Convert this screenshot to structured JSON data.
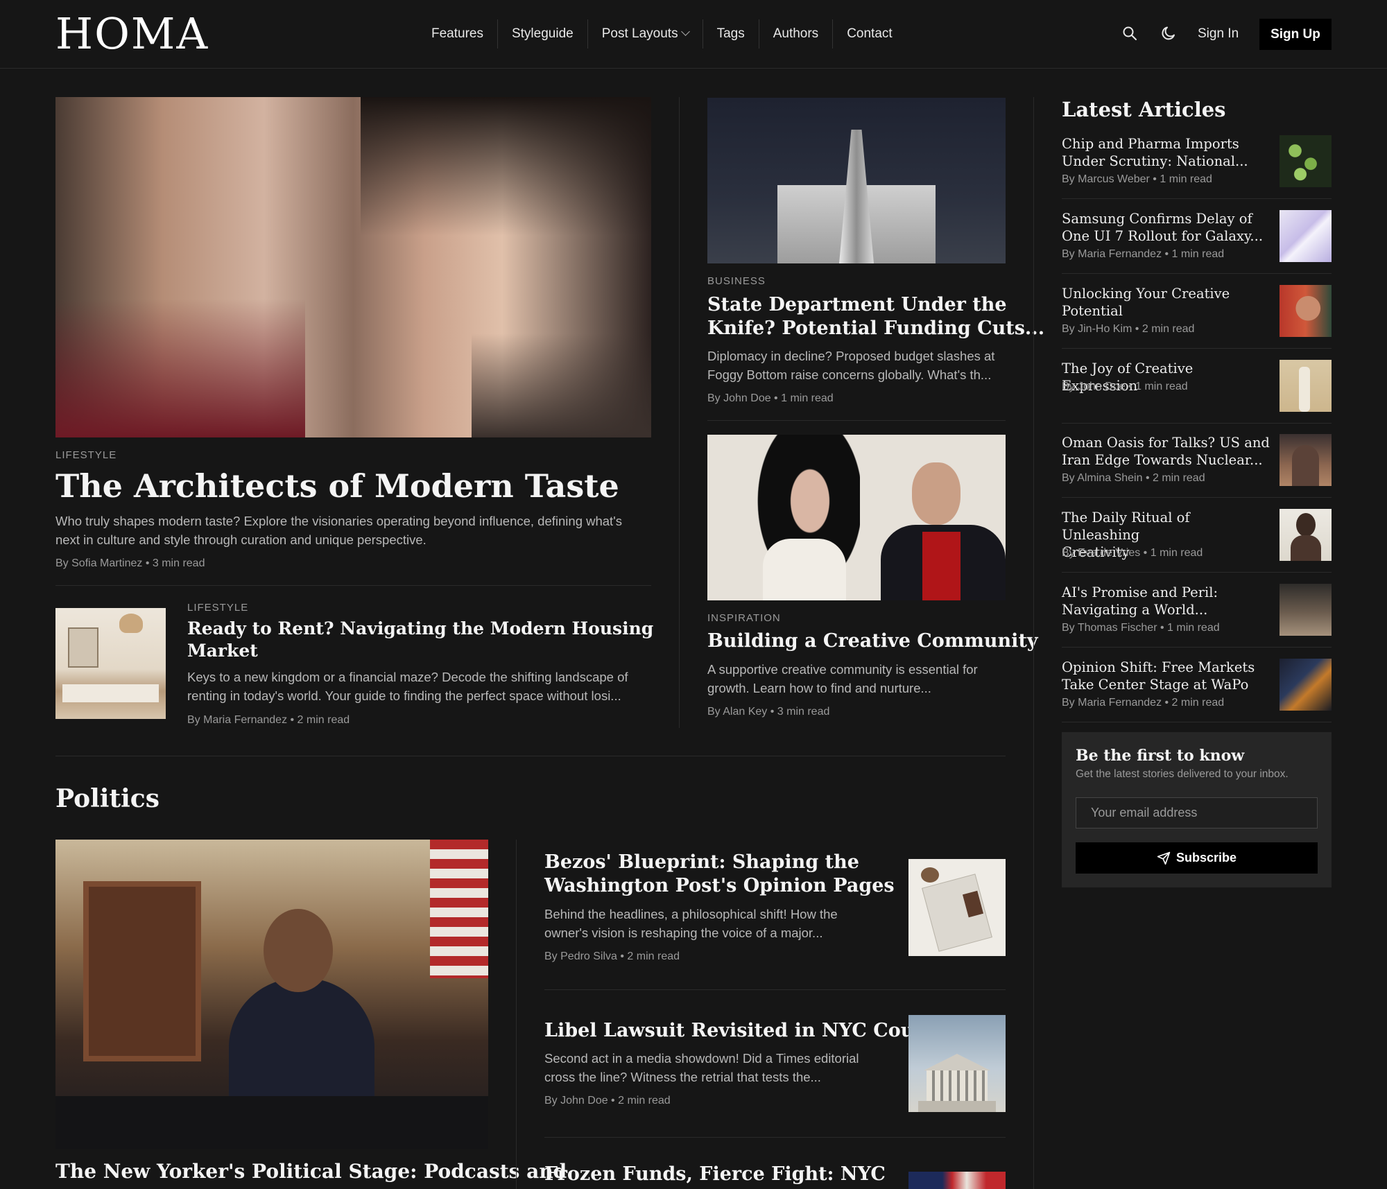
{
  "brand": {
    "logo": "HOMA"
  },
  "nav": {
    "items": [
      "Features",
      "Styleguide",
      "Post Layouts",
      "Tags",
      "Authors",
      "Contact"
    ],
    "sign_in": "Sign In",
    "sign_up": "Sign Up",
    "icons": [
      "search-icon",
      "moon-icon",
      "chevron-down-icon"
    ]
  },
  "hero": {
    "category": "LIFESTYLE",
    "title": "The Architects of Modern Taste",
    "excerpt_line1": "Who truly shapes modern taste? Explore the visionaries operating beyond influence, defining what's",
    "excerpt_line2": "next in culture and style through curation and unique perspective.",
    "meta": "By Sofia Martinez • 3 min read"
  },
  "secondary": {
    "category": "LIFESTYLE",
    "title_line1": "Ready to Rent? Navigating the Modern Housing",
    "title_line2": "Market",
    "excerpt_line1": "Keys to a new kingdom or a financial maze? Decode the shifting landscape of",
    "excerpt_line2": "renting in today's world. Your guide to finding the perfect space without losi...",
    "meta": "By Maria Fernandez • 2 min read"
  },
  "middle": [
    {
      "category": "BUSINESS",
      "title_line1": "State Department Under the",
      "title_line2": "Knife? Potential Funding Cuts...",
      "excerpt_line1": "Diplomacy in decline? Proposed budget slashes at",
      "excerpt_line2": "Foggy Bottom raise concerns globally. What's th...",
      "meta": "By John Doe • 1 min read"
    },
    {
      "category": "INSPIRATION",
      "title_line1": "Building a Creative Community",
      "excerpt_line1": "A supportive creative community is essential for",
      "excerpt_line2": "growth. Learn how to find and nurture...",
      "meta": "By Alan Key • 3 min read"
    }
  ],
  "sidebar": {
    "heading": "Latest Articles",
    "items": [
      {
        "l1": "Chip and Pharma Imports",
        "l2": "Under Scrutiny: National...",
        "meta": "By Marcus Weber • 1 min read"
      },
      {
        "l1": "Samsung Confirms Delay of",
        "l2": "One UI 7 Rollout for Galaxy...",
        "meta": "By Maria Fernandez • 1 min read"
      },
      {
        "l1": "Unlocking Your Creative",
        "l2": "Potential",
        "meta": "By Jin-Ho Kim • 2 min read"
      },
      {
        "l1": "The Joy of Creative Expression",
        "l2": "",
        "meta": "By John Doe • 1 min read"
      },
      {
        "l1": "Oman Oasis for Talks? US and",
        "l2": "Iran Edge Towards Nuclear...",
        "meta": "By Almina Shein • 2 min read"
      },
      {
        "l1": "The Daily Ritual of Unleashing",
        "l2": "Creativity",
        "meta": "By Eva de Vries • 1 min read"
      },
      {
        "l1": "AI's Promise and Peril:",
        "l2": "Navigating a World...",
        "meta": "By Thomas Fischer • 1 min read"
      },
      {
        "l1": "Opinion Shift: Free Markets",
        "l2": "Take Center Stage at WaPo",
        "meta": "By Maria Fernandez • 2 min read"
      }
    ]
  },
  "newsletter": {
    "title": "Be the first to know",
    "subtitle": "Get the latest stories delivered to your inbox.",
    "placeholder": "Your email address",
    "button": "Subscribe"
  },
  "politics": {
    "heading": "Politics",
    "lead_title": "The New Yorker's Political Stage: Podcasts and",
    "items": [
      {
        "title_line1": "Bezos' Blueprint: Shaping the",
        "title_line2": "Washington Post's Opinion Pages",
        "excerpt_line1": "Behind the headlines, a philosophical shift! How the",
        "excerpt_line2": "owner's vision is reshaping the voice of a major...",
        "meta": "By Pedro Silva • 2 min read"
      },
      {
        "title_line1": "Libel Lawsuit Revisited in NYC Court",
        "excerpt_line1": "Second act in a media showdown! Did a Times editorial",
        "excerpt_line2": "cross the line? Witness the retrial that tests the...",
        "meta": "By John Doe • 2 min read"
      },
      {
        "title_line1": "Frozen Funds, Fierce Fight: NYC"
      }
    ]
  }
}
